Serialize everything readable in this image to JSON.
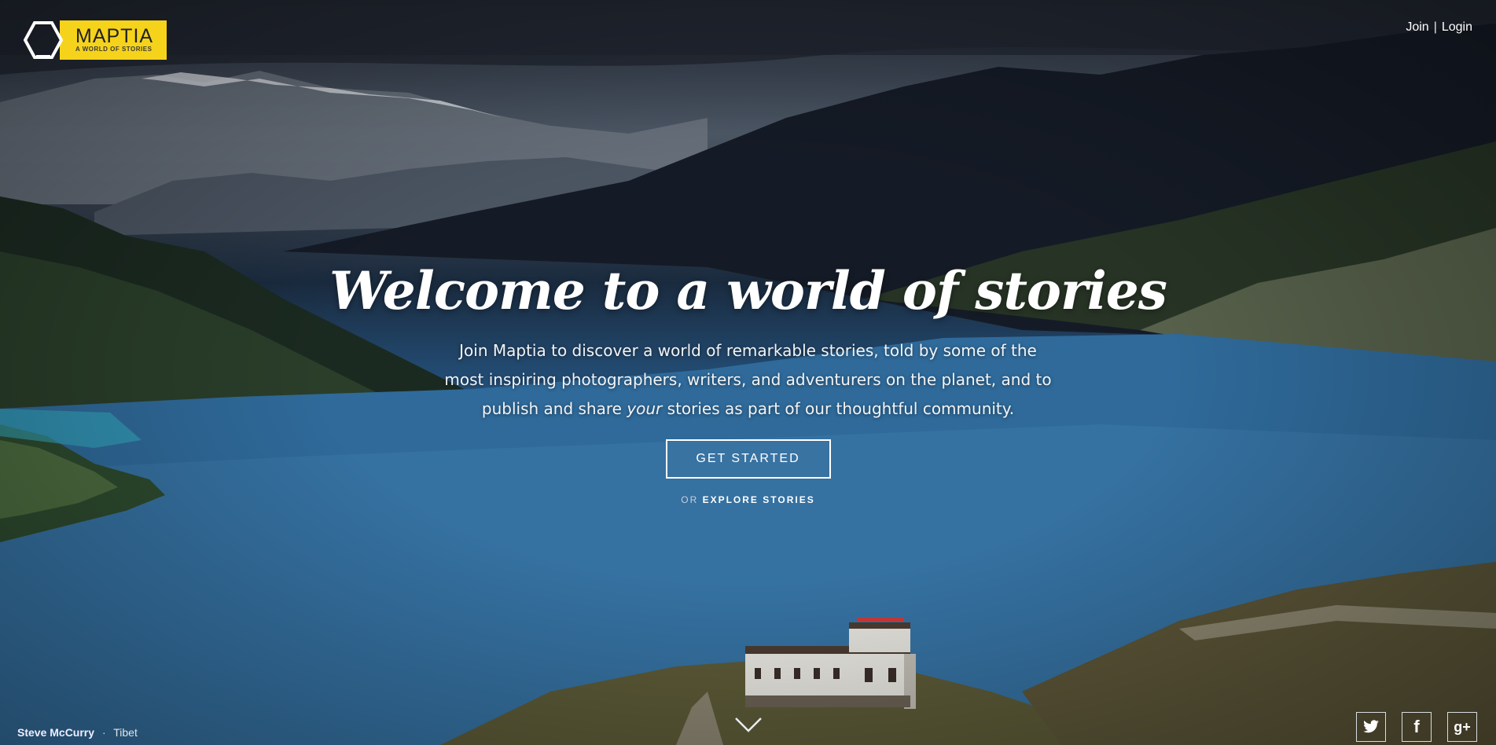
{
  "brand": {
    "name": "MAPTIA",
    "tagline": "A WORLD OF STORIES",
    "accent_color": "#f6d31b"
  },
  "nav": {
    "join_label": "Join",
    "separator": "|",
    "login_label": "Login"
  },
  "hero": {
    "headline": "Welcome to a world of stories",
    "lede_before": "Join Maptia to discover a world of remarkable stories, told by some of the most inspiring photographers, writers, and adventurers on the planet, and to publish and share ",
    "lede_emphasis": "your",
    "lede_after": " stories as part of our thoughtful community.",
    "cta_label": "GET STARTED",
    "explore_prefix": "OR",
    "explore_label": "EXPLORE STORIES"
  },
  "photo_credit": {
    "photographer": "Steve McCurry",
    "separator": "·",
    "location": "Tibet"
  },
  "icons": {
    "logo": "hexagon-logo-icon",
    "scroll": "chevron-down-icon",
    "social": [
      "twitter-icon",
      "facebook-icon",
      "google-plus-icon"
    ]
  },
  "social": {
    "facebook_glyph": "f",
    "google_glyph": "g+"
  }
}
